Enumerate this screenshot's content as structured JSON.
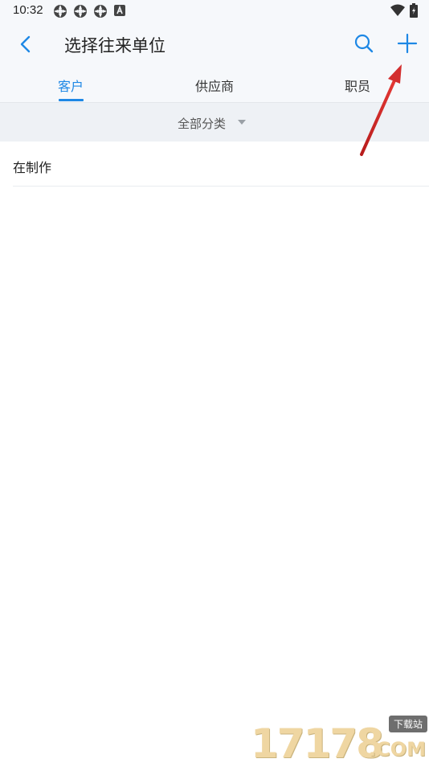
{
  "status_bar": {
    "time": "10:32",
    "notification_icons": [
      "app-icon",
      "app-icon",
      "app-icon",
      "a-icon"
    ],
    "right_icons": [
      "wifi-icon",
      "battery-icon"
    ]
  },
  "header": {
    "title": "选择往来单位",
    "back_icon": "chevron-left-icon",
    "search_icon": "search-icon",
    "add_icon": "plus-icon"
  },
  "tabs": [
    {
      "label": "客户",
      "active": true
    },
    {
      "label": "供应商",
      "active": false
    },
    {
      "label": "职员",
      "active": false
    }
  ],
  "filter": {
    "label": "全部分类",
    "caret_icon": "caret-down-icon"
  },
  "list": {
    "items": [
      {
        "label": "在制作"
      }
    ]
  },
  "colors": {
    "accent": "#1e88e5",
    "background": "#ffffff",
    "header_bg": "#f6f8fb",
    "filter_bg": "#eef1f5",
    "annotation_arrow": "#d32f2f"
  },
  "watermark": {
    "digits": "17178",
    "badge": "下载站",
    "domain": ".COM"
  }
}
